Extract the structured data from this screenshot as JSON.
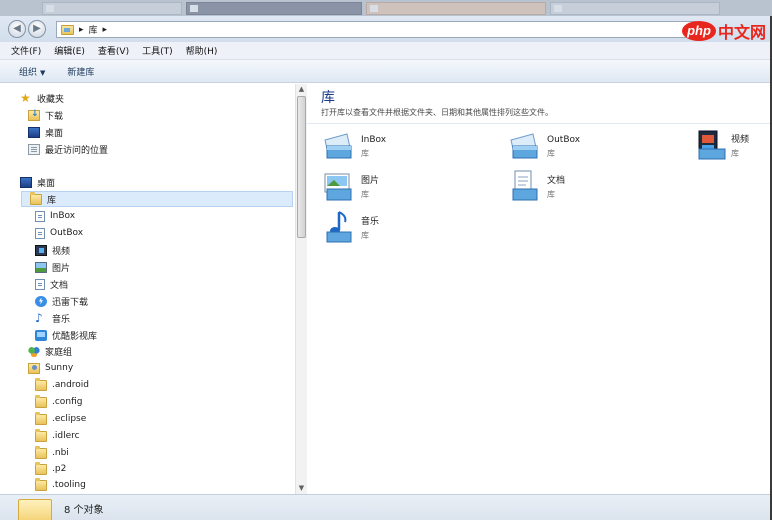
{
  "colors": {
    "accent_title": "#1e3a8a",
    "selection": "#dcebfc",
    "brand_red": "#e8261e"
  },
  "watermark": {
    "oval": "php",
    "text": "中文网"
  },
  "address": {
    "path": [
      "库"
    ],
    "separator": "▸",
    "back_icon": "back-arrow",
    "forward_icon": "forward-arrow"
  },
  "menu": [
    "文件(F)",
    "编辑(E)",
    "查看(V)",
    "工具(T)",
    "帮助(H)"
  ],
  "toolbar": {
    "organize": "组织",
    "new_library": "新建库"
  },
  "nav": {
    "favorites": {
      "label": "收藏夹",
      "items": [
        "下载",
        "桌面",
        "最近访问的位置"
      ]
    },
    "desktop": "桌面",
    "library": {
      "label": "库",
      "items": [
        "InBox",
        "OutBox",
        "视频",
        "图片",
        "文档",
        "迅雷下载",
        "音乐",
        "优酷影视库"
      ]
    },
    "homegroup": "家庭组",
    "user": {
      "label": "Sunny",
      "folders": [
        ".android",
        ".config",
        ".eclipse",
        ".idlerc",
        ".nbi",
        ".p2",
        ".tooling"
      ]
    }
  },
  "content": {
    "title": "库",
    "subtitle": "打开库以查看文件并根据文件夹、日期和其他属性排列这些文件。",
    "libraries": [
      {
        "name": "InBox",
        "type": "库",
        "icon": "generic-library"
      },
      {
        "name": "OutBox",
        "type": "库",
        "icon": "generic-library"
      },
      {
        "name": "视频",
        "type": "库",
        "icon": "video-library"
      },
      {
        "name": "图片",
        "type": "库",
        "icon": "picture-library"
      },
      {
        "name": "文档",
        "type": "库",
        "icon": "document-library"
      },
      {
        "name": "音乐",
        "type": "库",
        "icon": "music-library"
      }
    ]
  },
  "status": {
    "count_text": "8 个对象"
  }
}
